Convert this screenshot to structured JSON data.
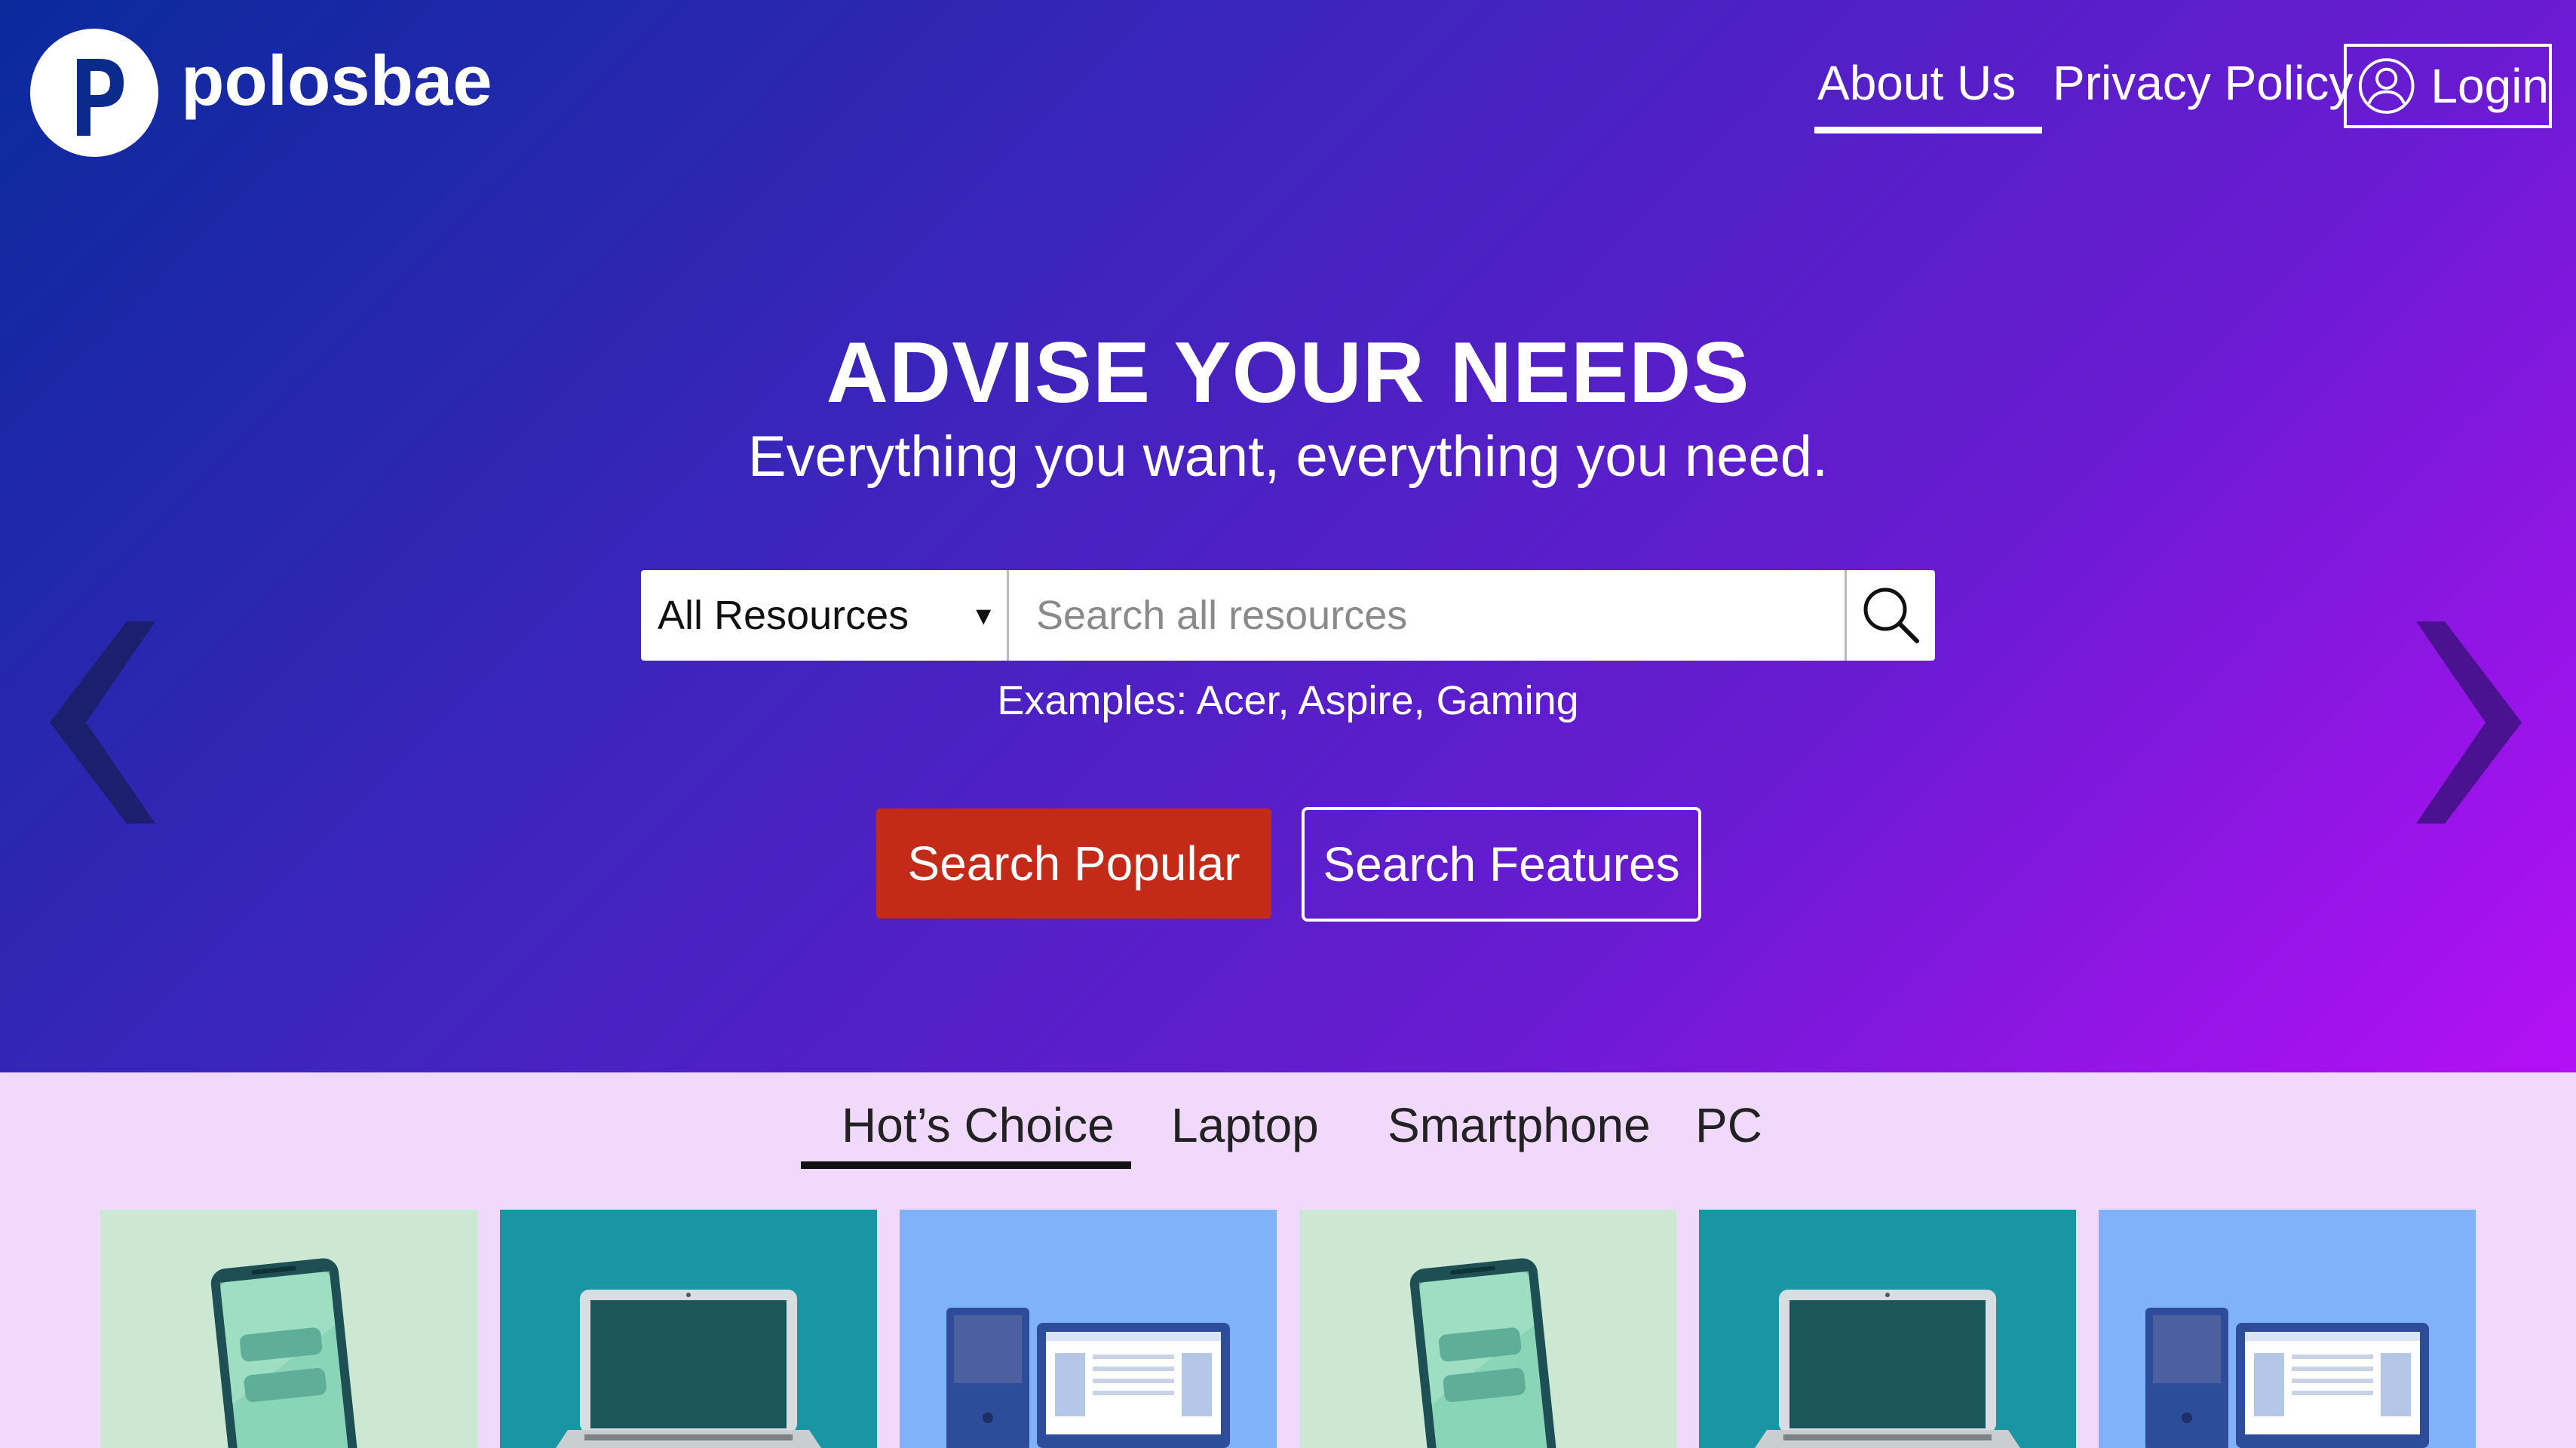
{
  "brand": {
    "name": "polosbae",
    "logo_letter": "P"
  },
  "nav": {
    "about": "About Us",
    "privacy": "Privacy Policy",
    "login": "Login"
  },
  "hero": {
    "headline": "ADVISE YOUR NEEDS",
    "subheadline": "Everything you want, everything you need.",
    "search": {
      "category": "All Resources",
      "placeholder": "Search all resources",
      "value": "",
      "examples": "Examples: Acer, Aspire, Gaming"
    },
    "buttons": {
      "popular": "Search Popular",
      "features": "Search Features"
    }
  },
  "carousel": {
    "prev_icon": "chevron-left-icon",
    "next_icon": "chevron-right-icon"
  },
  "tabs": [
    {
      "label": "Hot’s Choice",
      "active": true
    },
    {
      "label": "Laptop",
      "active": false
    },
    {
      "label": "Smartphone",
      "active": false
    },
    {
      "label": "PC",
      "active": false
    }
  ],
  "cards": [
    {
      "type": "smartphone",
      "icon": "smartphone-icon",
      "bg": "#cde8d2"
    },
    {
      "type": "laptop",
      "icon": "laptop-icon",
      "bg": "#1a95a4"
    },
    {
      "type": "pc",
      "icon": "desktop-pc-icon",
      "bg": "#7fb2f8"
    },
    {
      "type": "smartphone",
      "icon": "smartphone-icon",
      "bg": "#cde8d2"
    },
    {
      "type": "laptop",
      "icon": "laptop-icon",
      "bg": "#1a95a4"
    },
    {
      "type": "pc",
      "icon": "desktop-pc-icon",
      "bg": "#7fb2f8"
    }
  ],
  "colors": {
    "gradient_start": "#0a2a9c",
    "gradient_end": "#b410f5",
    "section_bg": "#f0d9fb",
    "primary_button": "#c32a18",
    "arrow_left": "#1c1e6e",
    "arrow_right": "#4a1290"
  }
}
